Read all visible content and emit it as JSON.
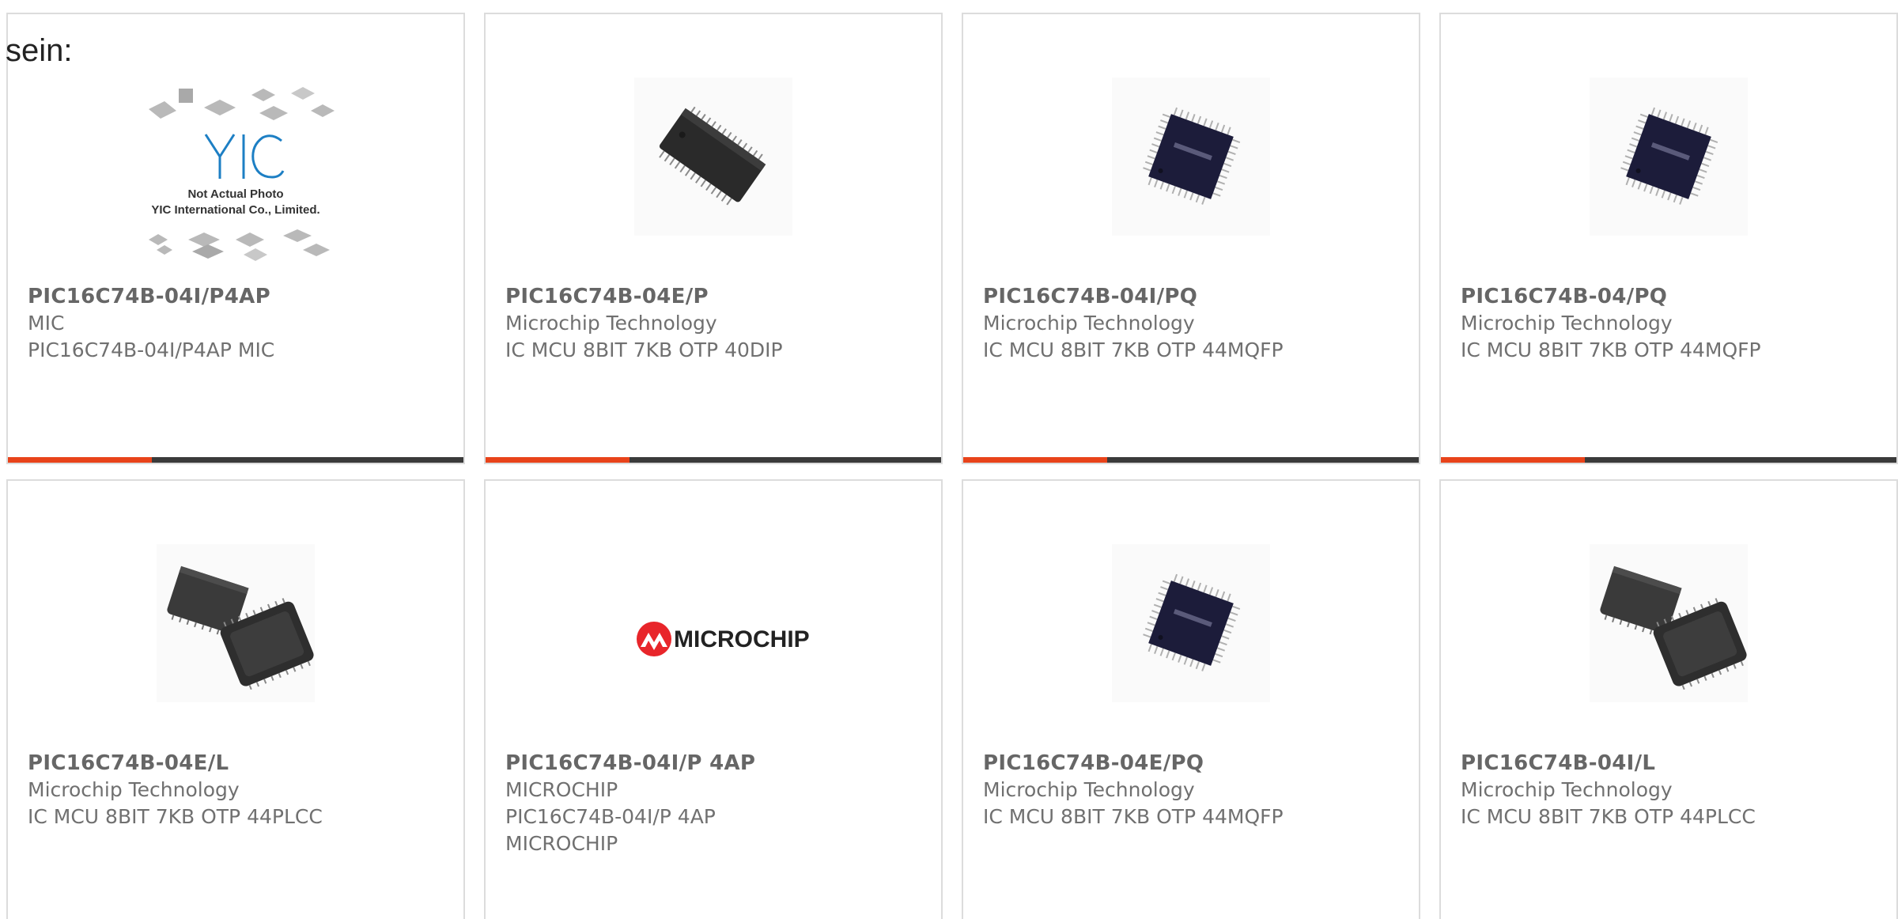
{
  "intro_text": "sein:",
  "colors": {
    "accent": "#e8431a",
    "bar_dark": "#3a3a3a",
    "text_gray": "#707070",
    "border": "#dcdcdc",
    "microchip_red": "#e8252a"
  },
  "products": [
    {
      "part_number": "PIC16C74B-04I/P4AP",
      "manufacturer": "MIC",
      "description": "PIC16C74B-04I/P4AP MIC",
      "image": "placeholder-photo",
      "image_caption_1": "Not Actual Photo",
      "image_caption_2": "YIC International Co., Limited.",
      "image_logo_text": "YIC",
      "has_bar": true
    },
    {
      "part_number": "PIC16C74B-04E/P",
      "manufacturer": "Microchip Technology",
      "description": "IC MCU 8BIT 7KB OTP 40DIP",
      "image": "dip-chip",
      "has_bar": true
    },
    {
      "part_number": "PIC16C74B-04I/PQ",
      "manufacturer": "Microchip Technology",
      "description": "IC MCU 8BIT 7KB OTP 44MQFP",
      "image": "qfp-chip",
      "has_bar": true
    },
    {
      "part_number": "PIC16C74B-04/PQ",
      "manufacturer": "Microchip Technology",
      "description": "IC MCU 8BIT 7KB OTP 44MQFP",
      "image": "qfp-chip",
      "has_bar": true
    },
    {
      "part_number": "PIC16C74B-04E/L",
      "manufacturer": "Microchip Technology",
      "description": "IC MCU 8BIT 7KB OTP 44PLCC",
      "image": "plcc-chip",
      "has_bar": false
    },
    {
      "part_number": "PIC16C74B-04I/P 4AP",
      "manufacturer": "MICROCHIP",
      "description_line_1": "PIC16C74B-04I/P 4AP",
      "description_line_2": "MICROCHIP",
      "image": "microchip-logo",
      "image_logo_text": "MICROCHIP",
      "has_bar": false
    },
    {
      "part_number": "PIC16C74B-04E/PQ",
      "manufacturer": "Microchip Technology",
      "description": "IC MCU 8BIT 7KB OTP 44MQFP",
      "image": "qfp-chip",
      "has_bar": false
    },
    {
      "part_number": "PIC16C74B-04I/L",
      "manufacturer": "Microchip Technology",
      "description": "IC MCU 8BIT 7KB OTP 44PLCC",
      "image": "plcc-chip",
      "has_bar": false
    }
  ]
}
